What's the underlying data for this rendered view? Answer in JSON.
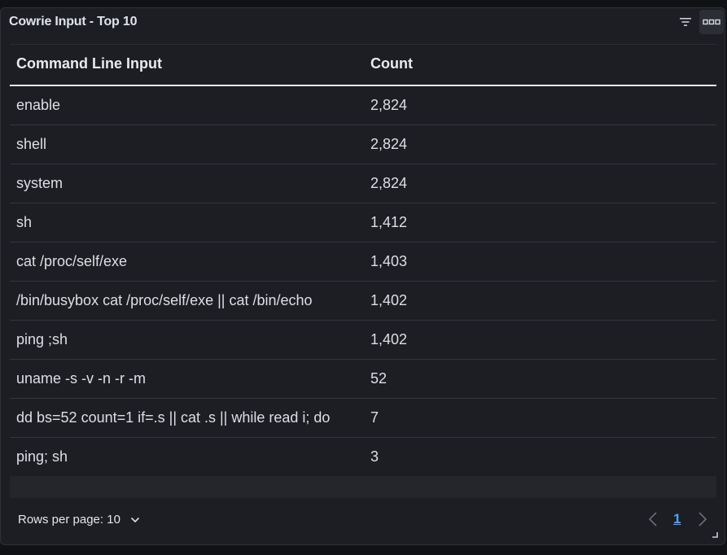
{
  "panel": {
    "title": "Cowrie Input - Top 10",
    "icons": {
      "filter": "filter-icon",
      "menu": "more-options-icon",
      "resize": "resize-handle-icon"
    }
  },
  "table": {
    "columns": [
      "Command Line Input",
      "Count"
    ],
    "rows": [
      {
        "command": "enable",
        "count": "2,824"
      },
      {
        "command": "shell",
        "count": "2,824"
      },
      {
        "command": "system",
        "count": "2,824"
      },
      {
        "command": "sh",
        "count": "1,412"
      },
      {
        "command": "cat /proc/self/exe",
        "count": "1,403"
      },
      {
        "command": "/bin/busybox cat /proc/self/exe || cat /bin/echo",
        "count": "1,402"
      },
      {
        "command": "ping ;sh",
        "count": "1,402"
      },
      {
        "command": "uname -s -v -n -r -m",
        "count": "52"
      },
      {
        "command": "dd bs=52 count=1 if=.s || cat .s || while read i; do",
        "count": "7"
      },
      {
        "command": "ping; sh",
        "count": "3"
      }
    ]
  },
  "footer": {
    "rows_per_page_label": "Rows per page: 10",
    "current_page": "1"
  },
  "colors": {
    "background": "#1d1e24",
    "text": "#dcdfe5",
    "accent": "#4fa3ff",
    "divider": "#34363d"
  }
}
